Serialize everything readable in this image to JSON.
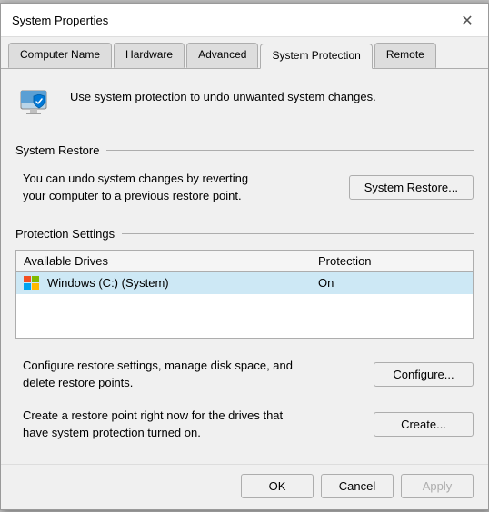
{
  "window": {
    "title": "System Properties"
  },
  "tabs": [
    {
      "id": "computer-name",
      "label": "Computer Name",
      "active": false
    },
    {
      "id": "hardware",
      "label": "Hardware",
      "active": false
    },
    {
      "id": "advanced",
      "label": "Advanced",
      "active": false
    },
    {
      "id": "system-protection",
      "label": "System Protection",
      "active": true
    },
    {
      "id": "remote",
      "label": "Remote",
      "active": false
    }
  ],
  "info": {
    "text": "Use system protection to undo unwanted system changes."
  },
  "system_restore": {
    "section_label": "System Restore",
    "description": "You can undo system changes by reverting\nyour computer to a previous restore point.",
    "button_label": "System Restore..."
  },
  "protection_settings": {
    "section_label": "Protection Settings",
    "table": {
      "col_drive": "Available Drives",
      "col_protection": "Protection",
      "rows": [
        {
          "drive_name": "Windows (C:) (System)",
          "protection": "On"
        }
      ]
    }
  },
  "configure": {
    "description": "Configure restore settings, manage disk space, and\ndelete restore points.",
    "button_label": "Configure..."
  },
  "create": {
    "description": "Create a restore point right now for the drives that\nhave system protection turned on.",
    "button_label": "Create..."
  },
  "footer": {
    "ok_label": "OK",
    "cancel_label": "Cancel",
    "apply_label": "Apply"
  }
}
